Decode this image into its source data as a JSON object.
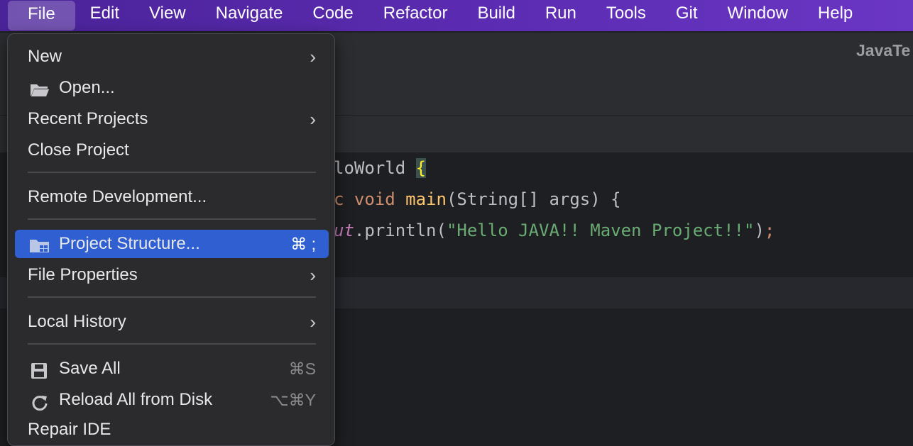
{
  "menubar": {
    "items": [
      "File",
      "Edit",
      "View",
      "Navigate",
      "Code",
      "Refactor",
      "Build",
      "Run",
      "Tools",
      "Git",
      "Window",
      "Help"
    ]
  },
  "window": {
    "title": "JavaTe"
  },
  "code": {
    "line1": {
      "a": "loWorld ",
      "b": "{"
    },
    "line2": {
      "a": "c ",
      "b": "void ",
      "c": "main",
      "d": "(String[] args) {"
    },
    "line3": {
      "a": "ut",
      "b": ".println(",
      "c": "\"Hello JAVA!! Maven Project!!\"",
      "d": ")",
      "e": ";"
    }
  },
  "file_menu": {
    "new": "New",
    "open": "Open...",
    "recent_projects": "Recent Projects",
    "close_project": "Close Project",
    "remote_development": "Remote Development...",
    "project_structure": "Project Structure...",
    "project_structure_shortcut": "⌘ ;",
    "file_properties": "File Properties",
    "local_history": "Local History",
    "save_all": "Save All",
    "save_all_shortcut": "⌘S",
    "reload_all": "Reload All from Disk",
    "reload_all_shortcut": "⌥⌘Y",
    "repair_ide": "Repair IDE"
  },
  "icons": {
    "open": "folder-open-icon",
    "project_structure": "project-structure-icon",
    "save_all": "save-icon",
    "reload_all": "reload-icon",
    "submenu": "chevron-right-icon"
  },
  "colors": {
    "menubar_accent": "#5a2bb0",
    "selection": "#2f5fd0",
    "menu_bg": "#2b2b2e"
  }
}
